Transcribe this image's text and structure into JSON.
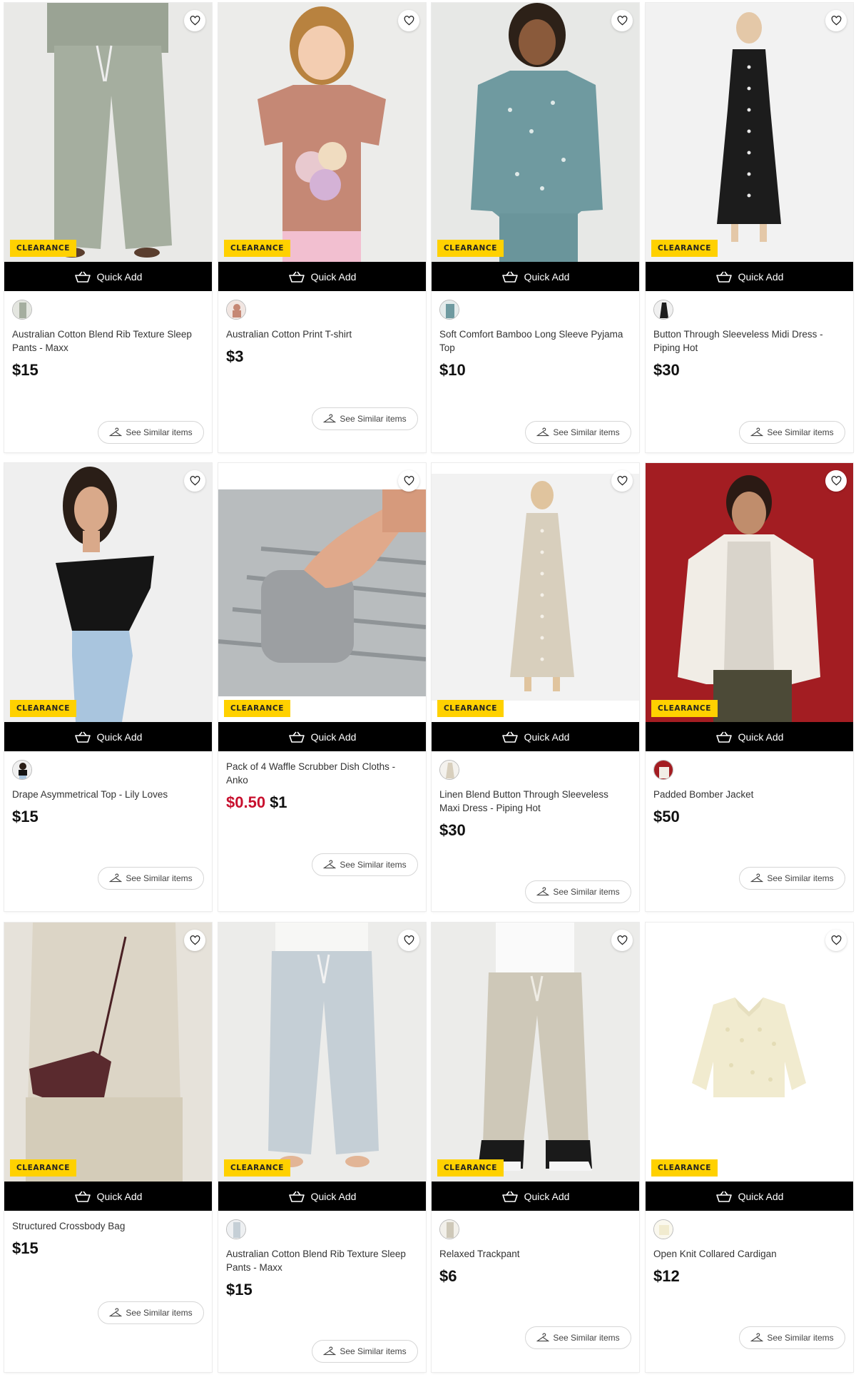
{
  "labels": {
    "badge": "CLEARANCE",
    "quick_add": "Quick Add",
    "see_similar": "See Similar items"
  },
  "colors": {
    "badge": "#ffd100",
    "quick_add_bg": "#000000",
    "sale_price": "#c8102e"
  },
  "products": [
    {
      "title": "Australian Cotton Blend Rib Texture Sleep Pants - Maxx",
      "price": "$15",
      "sale_price": "",
      "swatch": "sage-grey",
      "icon": "sleep-pants"
    },
    {
      "title": "Australian Cotton Print T-shirt",
      "price": "$3",
      "sale_price": "",
      "swatch": "dusty-pink",
      "icon": "kids-tshirt"
    },
    {
      "title": "Soft Comfort Bamboo Long Sleeve Pyjama Top",
      "price": "$10",
      "sale_price": "",
      "swatch": "teal-floral",
      "icon": "pyjama-top"
    },
    {
      "title": "Button Through Sleeveless Midi Dress - Piping Hot",
      "price": "$30",
      "sale_price": "",
      "swatch": "black",
      "icon": "midi-dress"
    },
    {
      "title": "Drape Asymmetrical Top - Lily Loves",
      "price": "$15",
      "sale_price": "",
      "swatch": "black",
      "icon": "drape-top"
    },
    {
      "title": "Pack of 4 Waffle Scrubber Dish Cloths - Anko",
      "price": "$1",
      "sale_price": "$0.50",
      "swatch": "",
      "icon": "dish-cloth"
    },
    {
      "title": "Linen Blend Button Through Sleeveless Maxi Dress - Piping Hot",
      "price": "$30",
      "sale_price": "",
      "swatch": "natural",
      "icon": "maxi-dress"
    },
    {
      "title": "Padded Bomber Jacket",
      "price": "$50",
      "sale_price": "",
      "swatch": "red",
      "icon": "bomber-jacket"
    },
    {
      "title": "Structured Crossbody Bag",
      "price": "$15",
      "sale_price": "",
      "swatch": "",
      "icon": "crossbody-bag"
    },
    {
      "title": "Australian Cotton Blend Rib Texture Sleep Pants - Maxx",
      "price": "$15",
      "sale_price": "",
      "swatch": "light-grey",
      "icon": "sleep-pants"
    },
    {
      "title": "Relaxed Trackpant",
      "price": "$6",
      "sale_price": "",
      "swatch": "stone",
      "icon": "trackpant"
    },
    {
      "title": "Open Knit Collared Cardigan",
      "price": "$12",
      "sale_price": "",
      "swatch": "cream",
      "icon": "cardigan"
    }
  ]
}
